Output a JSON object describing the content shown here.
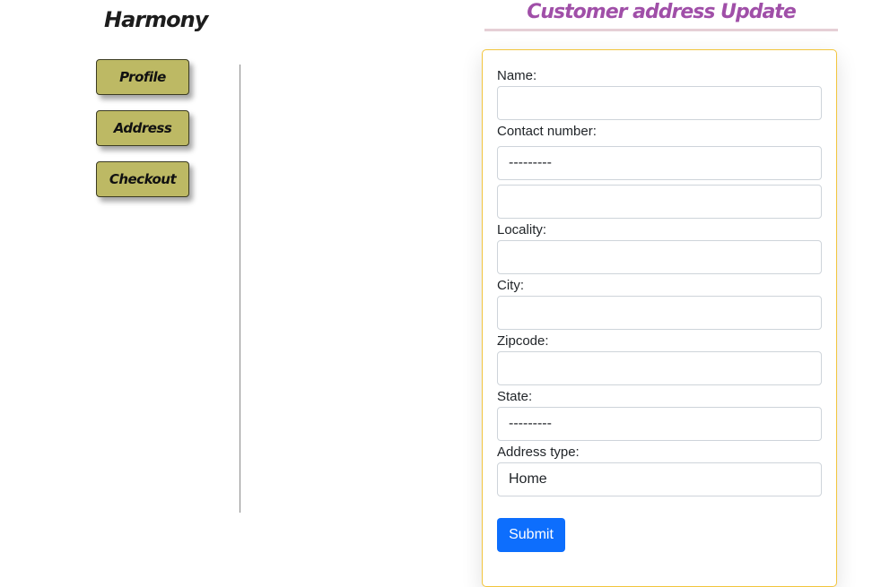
{
  "brand": {
    "name": "Harmony"
  },
  "sidebar": {
    "items": [
      {
        "label": "Profile"
      },
      {
        "label": "Address"
      },
      {
        "label": "Checkout"
      }
    ]
  },
  "page": {
    "title": "Customer address Update"
  },
  "form": {
    "name_label": "Name:",
    "name_value": "",
    "contact_label": "Contact number:",
    "contact_code_value": "---------",
    "contact_number_value": "",
    "locality_label": "Locality:",
    "locality_value": "",
    "city_label": "City:",
    "city_value": "",
    "zipcode_label": "Zipcode:",
    "zipcode_value": "",
    "state_label": "State:",
    "state_value": "---------",
    "address_type_label": "Address type:",
    "address_type_value": "Home",
    "submit_label": "Submit"
  },
  "colors": {
    "nav_button": "#bdb964",
    "title": "#a04fa8",
    "card_border": "#f2c53d",
    "submit": "#0d6efd"
  }
}
